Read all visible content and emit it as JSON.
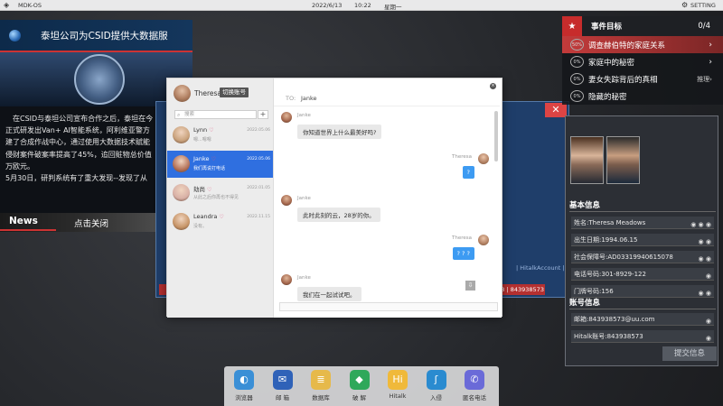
{
  "topbar": {
    "os_name": "MDK-OS",
    "date": "2022/6/13",
    "time": "10:22",
    "weekday": "星期一",
    "setting": "SETTING"
  },
  "news": {
    "headline": "泰坦公司为CSID提供大数据服",
    "body_lines": [
      "　在CSID与泰坦公司宣布合作之后，泰坦在今",
      "正式研发出Van+ AI智能系统，阿利维亚警方",
      "建了合成作战中心，通过使用大数据技术赋能",
      "侵财案件破案率提高了45%，追回赃物总价值",
      "万欧元。",
      "5月30日，研判系统有了重大发现--发现了从"
    ],
    "tag": "News",
    "close_label": "点击关闭"
  },
  "bg_window": {
    "close_glyph": "✕",
    "hitalk_text": "| HitalkAccount |",
    "red_text": "078 | 843938573"
  },
  "goals": {
    "title": "事件目标",
    "count": "0/4",
    "items": [
      {
        "pct": "50%",
        "text": "调查赫伯特的家庭关系",
        "suffix": "›",
        "active": true
      },
      {
        "pct": "0%",
        "text": "家庭中的秘密",
        "suffix": "›",
        "active": false
      },
      {
        "pct": "0%",
        "text": "妻女失踪背后的真相",
        "suffix": "推理›",
        "active": false
      },
      {
        "pct": "0%",
        "text": "隐藏的秘密",
        "suffix": "",
        "active": false
      }
    ]
  },
  "profile": {
    "basic_title": "基本信息",
    "basic_rows": [
      {
        "text": "姓名:Theresa Meadows",
        "icons": "◉ ◉ ◉"
      },
      {
        "text": "出生日期:1994.06.15",
        "icons": "◉ ◉"
      },
      {
        "text": "社会保障号:AD03319940615078",
        "icons": "◉ ◉"
      },
      {
        "text": "电话号码:301-8929-122",
        "icons": "◉"
      },
      {
        "text": "门牌号码:156",
        "icons": "◉ ◉"
      }
    ],
    "account_title": "账号信息",
    "account_rows": [
      {
        "text": "邮箱:843938573@uu.com",
        "icons": "◉"
      },
      {
        "text": "Hitalk账号:843938573",
        "icons": "◉"
      }
    ],
    "submit_label": "提交信息"
  },
  "chat": {
    "me_name": "Theresa",
    "switch_label": "切换账号",
    "search_placeholder": "搜索",
    "add_glyph": "+",
    "contacts": [
      {
        "name": "Lynn",
        "date": "2022.05.06",
        "preview": "嗯...嗯嗯",
        "selected": false,
        "color": "#c9a27c"
      },
      {
        "name": "Janke",
        "date": "2022.05.06",
        "preview": "我们再说打电话",
        "selected": true,
        "color": "#b5735a"
      },
      {
        "name": "劫尚",
        "date": "2022.01.05",
        "preview": "从此之后你再也不得见",
        "selected": false,
        "color": "#d8b0a6"
      },
      {
        "name": "Leandra",
        "date": "2022.11.15",
        "preview": "没有。",
        "selected": false,
        "color": "#c79568"
      }
    ],
    "to_label": "TO:",
    "to_name": "Janke",
    "messages": [
      {
        "side": "left",
        "name": "Janke",
        "text": "你知道世界上什么最美好吗?"
      },
      {
        "side": "right",
        "name": "Theresa",
        "text": "?"
      },
      {
        "side": "left",
        "name": "Janke",
        "text": "此时此刻的云，28岁的你。"
      },
      {
        "side": "right",
        "name": "Theresa",
        "text": "? ? ?"
      },
      {
        "side": "left",
        "name": "Janke",
        "text": "我们在一起试试吧。"
      }
    ]
  },
  "dock": [
    {
      "label": "浏览器",
      "icon": "browser-icon",
      "glyph": "◐",
      "color": "#3a8fd6"
    },
    {
      "label": "邮 箱",
      "icon": "mail-icon",
      "glyph": "✉",
      "color": "#2f62b8"
    },
    {
      "label": "数据库",
      "icon": "database-icon",
      "glyph": "≣",
      "color": "#e6b94a"
    },
    {
      "label": "破 解",
      "icon": "crack-icon",
      "glyph": "◆",
      "color": "#2fa85a"
    },
    {
      "label": "Hitalk",
      "icon": "hitalk-icon",
      "glyph": "Hi",
      "color": "#f0b93a"
    },
    {
      "label": "入侵",
      "icon": "intrude-icon",
      "glyph": "ʃ",
      "color": "#2a8bd0"
    },
    {
      "label": "匿名电话",
      "icon": "phone-icon",
      "glyph": "✆",
      "color": "#6a6ad8"
    }
  ]
}
